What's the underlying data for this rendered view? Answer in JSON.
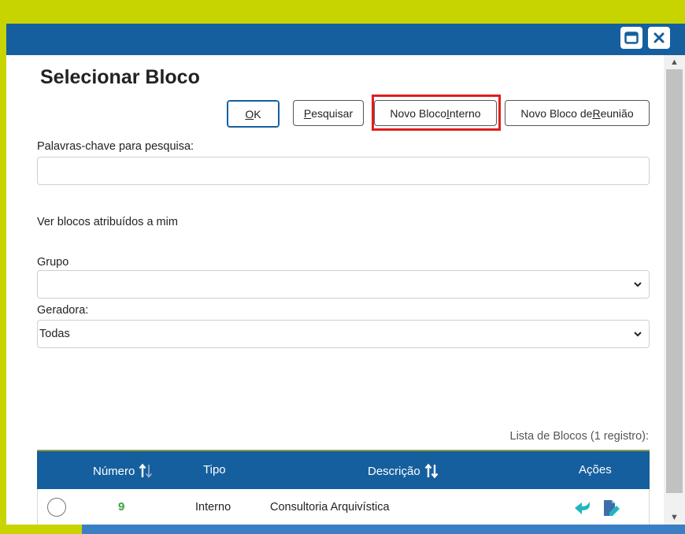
{
  "dialog": {
    "title": "Selecionar Bloco"
  },
  "window_controls": {
    "maximize_icon": "maximize-icon",
    "close_icon": "close-icon"
  },
  "buttons": {
    "ok": {
      "pre": "",
      "key": "O",
      "post": "K"
    },
    "pesquisar": {
      "pre": "",
      "key": "P",
      "post": "esquisar"
    },
    "novo_interno": {
      "pre": "Novo Bloco ",
      "key": "I",
      "post": "nterno"
    },
    "novo_reuniao": {
      "pre": "Novo Bloco de ",
      "key": "R",
      "post": "eunião"
    }
  },
  "form": {
    "keywords_label": "Palavras-chave para pesquisa:",
    "keywords_value": "",
    "assigned_label": "Ver blocos atribuídos a mim",
    "grupo_label": "Grupo",
    "grupo_value": "",
    "geradora_label": "Geradora:",
    "geradora_value": "Todas"
  },
  "list": {
    "caption": "Lista de Blocos (1 registro):",
    "columns": [
      "Número",
      "Tipo",
      "Descrição",
      "Ações"
    ],
    "rows": [
      {
        "numero": "9",
        "tipo": "Interno",
        "descricao": "Consultoria Arquivística"
      }
    ]
  },
  "colors": {
    "titlebar": "#155f9e",
    "background": "#c8d400",
    "highlight": "#e01e1e",
    "action_icon": "#1fb6c1",
    "number_green": "#3aa23a"
  }
}
